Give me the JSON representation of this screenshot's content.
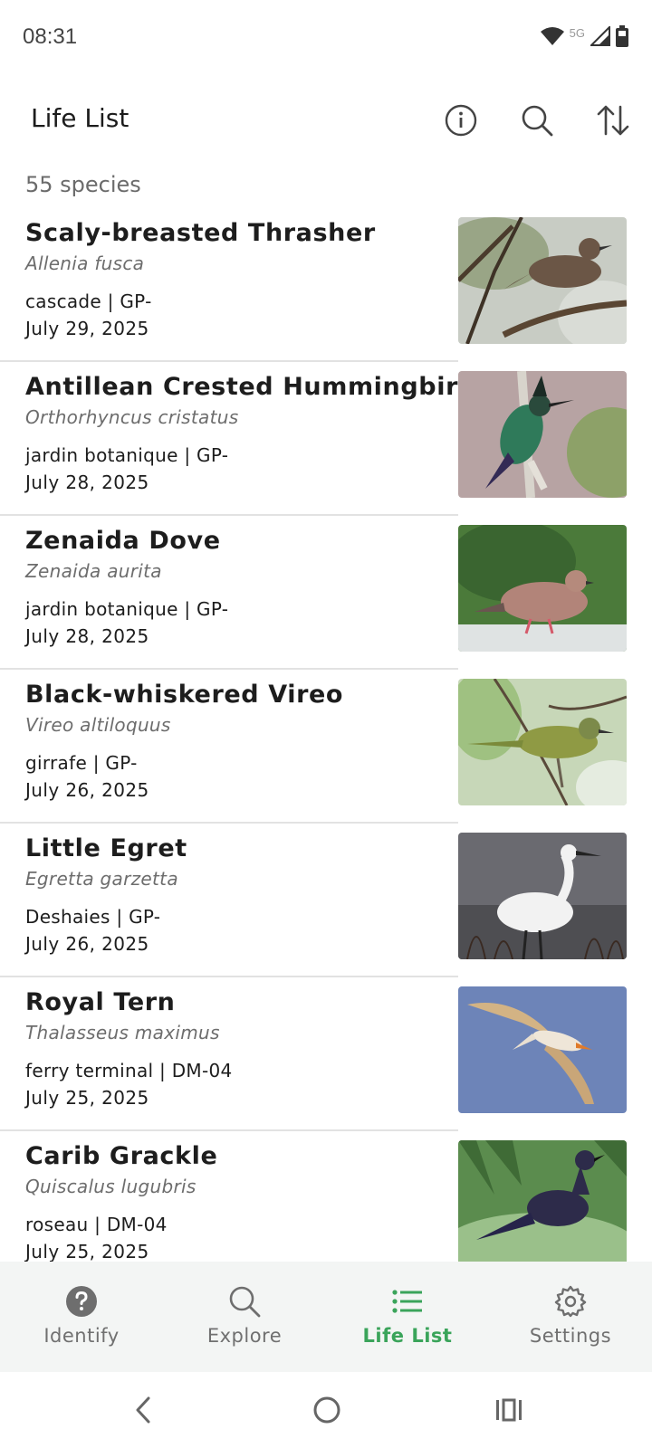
{
  "status_bar": {
    "time": "08:31",
    "network": "5G",
    "icons": [
      "wifi-icon",
      "cell-signal-icon",
      "battery-icon"
    ]
  },
  "app_bar": {
    "title": "Life List",
    "actions": [
      "info-icon",
      "search-icon",
      "sort-icon"
    ]
  },
  "species_count": "55 species",
  "entries": [
    {
      "common": "Scaly-breasted Thrasher",
      "scientific": "Allenia fusca",
      "location": "cascade | GP-",
      "date": "July 29, 2025"
    },
    {
      "common": "Antillean Crested Hummingbird",
      "scientific": "Orthorhyncus cristatus",
      "location": "jardin botanique | GP-",
      "date": "July 28, 2025"
    },
    {
      "common": "Zenaida Dove",
      "scientific": "Zenaida aurita",
      "location": "jardin botanique | GP-",
      "date": "July 28, 2025"
    },
    {
      "common": "Black-whiskered Vireo",
      "scientific": "Vireo altiloquus",
      "location": "girrafe | GP-",
      "date": "July 26, 2025"
    },
    {
      "common": "Little Egret",
      "scientific": "Egretta garzetta",
      "location": "Deshaies | GP-",
      "date": "July 26, 2025"
    },
    {
      "common": "Royal Tern",
      "scientific": "Thalasseus maximus",
      "location": "ferry terminal | DM-04",
      "date": "July 25, 2025"
    },
    {
      "common": "Carib Grackle",
      "scientific": "Quiscalus lugubris",
      "location": "roseau | DM-04",
      "date": "July 25, 2025"
    }
  ],
  "bottom_nav": [
    {
      "label": "Identify",
      "icon": "help-circle-icon",
      "active": false
    },
    {
      "label": "Explore",
      "icon": "search-icon",
      "active": false
    },
    {
      "label": "Life List",
      "icon": "list-icon",
      "active": true
    },
    {
      "label": "Settings",
      "icon": "gear-icon",
      "active": false
    }
  ],
  "colors": {
    "accent": "#3aa45a",
    "nav_background": "#f3f5f4",
    "secondary_text": "#6d6d6d"
  }
}
